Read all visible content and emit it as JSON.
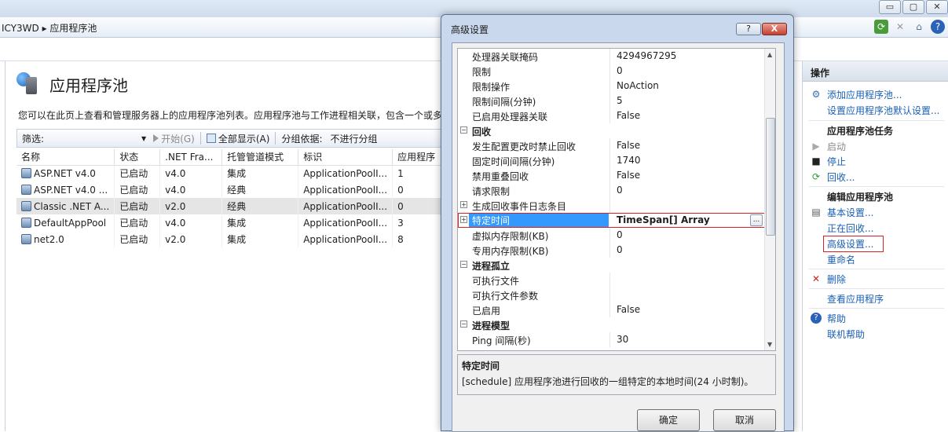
{
  "window": {
    "controls": [
      "▭",
      "▢",
      "✕"
    ]
  },
  "address": {
    "crumb": "ICY3WD  ▸  应用程序池"
  },
  "main": {
    "title": "应用程序池",
    "description": "您可以在此页上查看和管理服务器上的应用程序池列表。应用程序池与工作进程相关联，包含一个或多",
    "toolbar": {
      "filter_label": "筛选:",
      "start": "开始(G)",
      "show_all": "全部显示(A)",
      "group_label": "分组依据:",
      "group_value": "不进行分组"
    },
    "columns": [
      "名称",
      "状态",
      ".NET Fra...",
      "托管管道模式",
      "标识",
      "应用程序"
    ],
    "rows": [
      {
        "name": "ASP.NET v4.0",
        "status": "已启动",
        "net": "v4.0",
        "pipeline": "集成",
        "identity": "ApplicationPoolI...",
        "apps": "1"
      },
      {
        "name": "ASP.NET v4.0 ...",
        "status": "已启动",
        "net": "v4.0",
        "pipeline": "经典",
        "identity": "ApplicationPoolI...",
        "apps": "0"
      },
      {
        "name": "Classic .NET A...",
        "status": "已启动",
        "net": "v2.0",
        "pipeline": "经典",
        "identity": "ApplicationPoolI...",
        "apps": "0"
      },
      {
        "name": "DefaultAppPool",
        "status": "已启动",
        "net": "v4.0",
        "pipeline": "集成",
        "identity": "ApplicationPoolI...",
        "apps": "3"
      },
      {
        "name": "net2.0",
        "status": "已启动",
        "net": "v2.0",
        "pipeline": "集成",
        "identity": "ApplicationPoolI...",
        "apps": "8"
      }
    ]
  },
  "actions": {
    "header": "操作",
    "add_pool": "添加应用程序池...",
    "set_defaults": "设置应用程序池默认设置...",
    "tasks_header": "应用程序池任务",
    "start": "启动",
    "stop": "停止",
    "recycle": "回收...",
    "edit_header": "编辑应用程序池",
    "basic_settings": "基本设置...",
    "recycling": "正在回收...",
    "advanced_settings": "高级设置...",
    "rename": "重命名",
    "delete": "删除",
    "view_apps": "查看应用程序",
    "help": "帮助",
    "online_help": "联机帮助"
  },
  "dialog": {
    "title": "高级设置",
    "help_btn": "?",
    "close_btn": "X",
    "properties": [
      {
        "key": "处理器关联掩码",
        "value": "4294967295"
      },
      {
        "key": "限制",
        "value": "0"
      },
      {
        "key": "限制操作",
        "value": "NoAction"
      },
      {
        "key": "限制间隔(分钟)",
        "value": "5"
      },
      {
        "key": "已启用处理器关联",
        "value": "False"
      },
      {
        "key": "回收",
        "value": ""
      },
      {
        "key": "发生配置更改时禁止回收",
        "value": "False"
      },
      {
        "key": "固定时间间隔(分钟)",
        "value": "1740"
      },
      {
        "key": "禁用重叠回收",
        "value": "False"
      },
      {
        "key": "请求限制",
        "value": "0"
      },
      {
        "key": "生成回收事件日志条目",
        "value": ""
      },
      {
        "key": "特定时间",
        "value": "TimeSpan[] Array"
      },
      {
        "key": "虚拟内存限制(KB)",
        "value": "0"
      },
      {
        "key": "专用内存限制(KB)",
        "value": "0"
      },
      {
        "key": "进程孤立",
        "value": ""
      },
      {
        "key": "可执行文件",
        "value": ""
      },
      {
        "key": "可执行文件参数",
        "value": ""
      },
      {
        "key": "已启用",
        "value": "False"
      },
      {
        "key": "进程模型",
        "value": ""
      },
      {
        "key": "Ping 间隔(秒)",
        "value": "30"
      }
    ],
    "ellipsis": "...",
    "desc_title": "特定时间",
    "desc_text": "[schedule] 应用程序池进行回收的一组特定的本地时间(24 小时制)。",
    "ok": "确定",
    "cancel": "取消"
  }
}
